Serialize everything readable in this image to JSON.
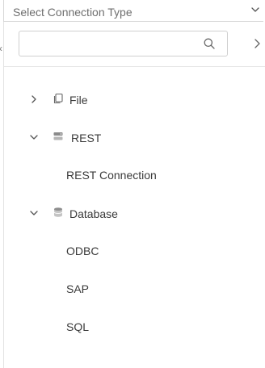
{
  "select": {
    "placeholder": "Select Connection Type",
    "icon": "chevron-down-icon"
  },
  "search": {
    "value": "",
    "placeholder": "",
    "icon": "search-icon"
  },
  "nav": {
    "left_icon": "chevron-left-icon",
    "right_icon": "chevron-right-icon"
  },
  "tree": {
    "file": {
      "label": "File",
      "expanded": false,
      "icon": "file-copy-icon"
    },
    "rest": {
      "label": "REST",
      "expanded": true,
      "icon": "server-icon",
      "children": [
        "REST Connection"
      ]
    },
    "database": {
      "label": "Database",
      "expanded": true,
      "icon": "database-icon",
      "children": [
        "ODBC",
        "SAP",
        "SQL"
      ]
    }
  },
  "colors": {
    "text": "#3a3a3a",
    "placeholder": "#6e6e6e",
    "border": "#cfcfcf",
    "icon": "#666666"
  }
}
